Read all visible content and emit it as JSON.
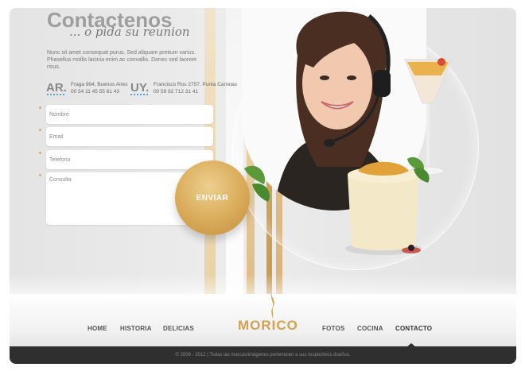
{
  "header": {
    "title": "Contactenos",
    "tagline": "... o pida su reunion",
    "intro": "Nunc sit amet consequat purus. Sed aliquam pretium varius. Phasellus mollis lacinia enim ac convallis. Donec sed laoreet risus."
  },
  "offices": [
    {
      "code": "AR.",
      "line1": "Fraga 964, Buenos Aires",
      "line2": "00 54 11 45 55 61 43"
    },
    {
      "code": "UY.",
      "line1": "Francisco Ros 2757, Punta Carretas",
      "line2": "00 59 82 712 31 41"
    }
  ],
  "form": {
    "name_placeholder": "Nombre",
    "email_placeholder": "Email",
    "phone_placeholder": "Telefono",
    "message_placeholder": "Consulta",
    "submit_label": "ENVIAR"
  },
  "nav": {
    "items": [
      "HOME",
      "HISTORIA",
      "DELICIAS",
      "FOTOS",
      "COCINA",
      "CONTACTO"
    ],
    "active": "CONTACTO",
    "logo": "MORICO"
  },
  "footer": {
    "text": "© 2006 - 2012 | Todas las marcas/imágenes pertenecen a sus respectivos dueños."
  },
  "colors": {
    "accent": "#d4a24e",
    "footer_bg": "#2f2f2f"
  }
}
